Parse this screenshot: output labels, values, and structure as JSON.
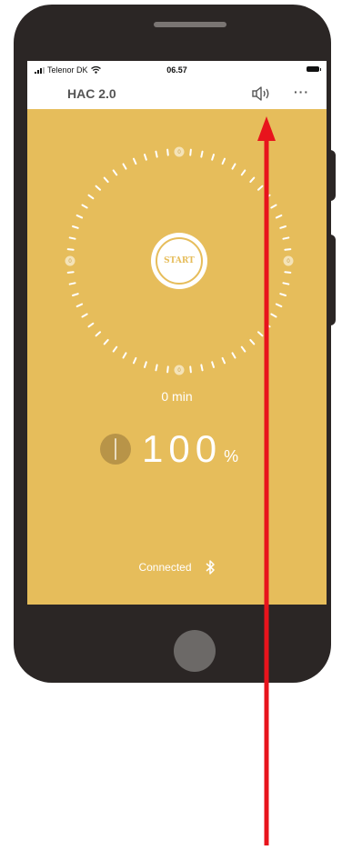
{
  "status_bar": {
    "carrier": "Telenor DK",
    "time": "06.57"
  },
  "app_bar": {
    "title": "HAC 2.0",
    "sound_icon": "speaker-icon",
    "more_icon": "more-icon",
    "more_label": "···"
  },
  "dial": {
    "start_label": "START",
    "marker_label": "0"
  },
  "session": {
    "duration": "0 min",
    "level_value": "100",
    "level_unit": "%"
  },
  "connection": {
    "status": "Connected",
    "icon": "bluetooth-icon"
  },
  "colors": {
    "screen_bg": "#e6bd5b",
    "phone_body": "#2b2625",
    "arrow": "#e8141c",
    "knob": "#b89448"
  }
}
